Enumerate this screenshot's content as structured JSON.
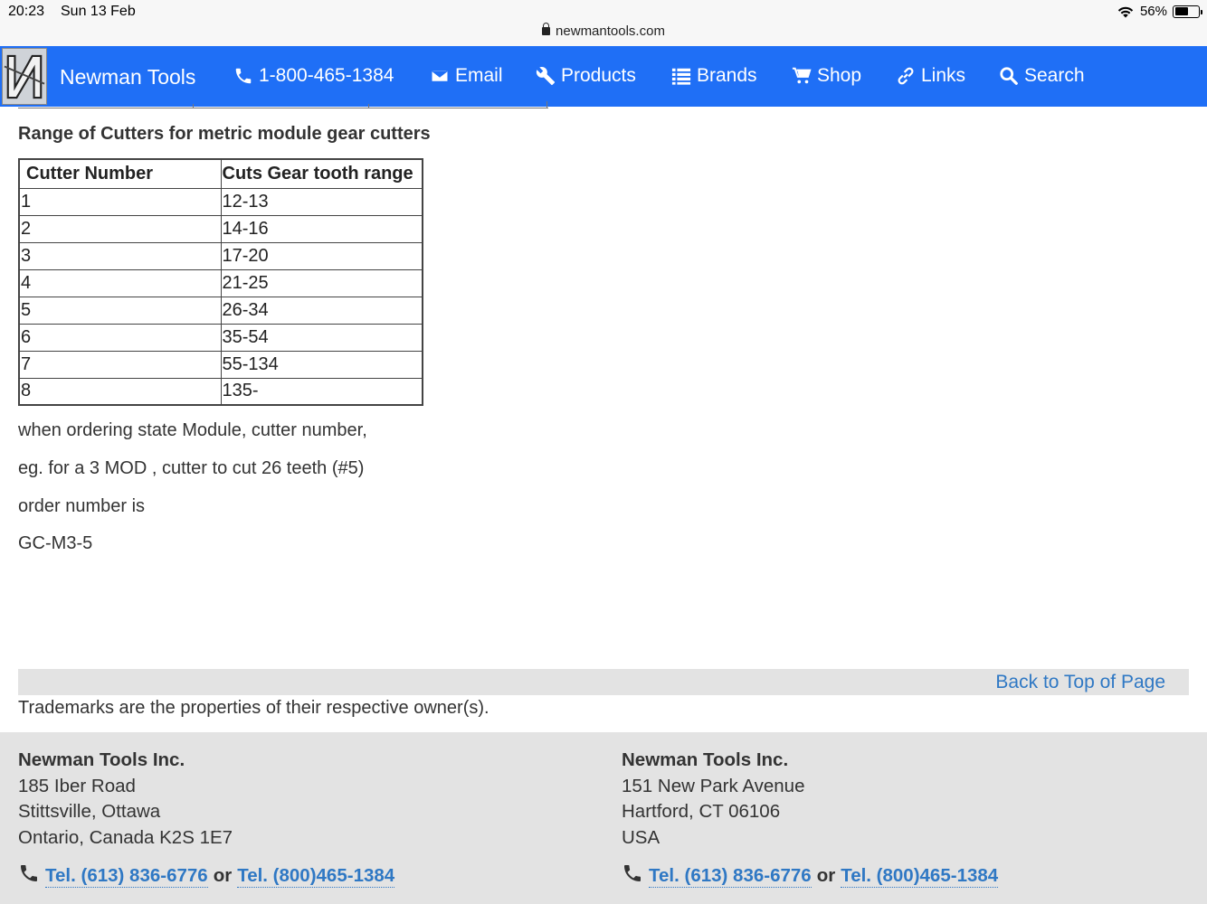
{
  "statusbar": {
    "time": "20:23",
    "date": "Sun 13 Feb",
    "url": "newmantools.com",
    "battery": "56%",
    "battery_level": 0.56
  },
  "nav": {
    "brand": "Newman Tools",
    "phone": "1-800-465-1384",
    "email": "Email",
    "products": "Products",
    "brands": "Brands",
    "shop": "Shop",
    "links": "Links",
    "search": "Search",
    "bg_color": "#1f6ff6"
  },
  "content": {
    "section_title": "Range of Cutters for metric module gear cutters",
    "table": {
      "headers": [
        "Cutter Number",
        "Cuts Gear tooth range"
      ],
      "rows": [
        [
          "1",
          "12-13"
        ],
        [
          "2",
          "14-16"
        ],
        [
          "3",
          "17-20"
        ],
        [
          "4",
          "21-25"
        ],
        [
          "5",
          "26-34"
        ],
        [
          "6",
          "35-54"
        ],
        [
          "7",
          "55-134"
        ],
        [
          "8",
          "135-"
        ]
      ]
    },
    "para1": "when ordering state Module, cutter number,",
    "para2": "eg. for a 3 MOD , cutter to cut 26 teeth (#5)",
    "para3": "order number is",
    "para4": "GC-M3-5",
    "back_to_top": "Back to Top of Page",
    "trademarks": "Trademarks are the properties of their respective owner(s)."
  },
  "footer": {
    "left": {
      "name": "Newman Tools Inc.",
      "line1": "185 Iber Road",
      "line2": "Stittsville, Ottawa",
      "line3": "Ontario, Canada K2S 1E7",
      "tel1": "Tel. (613) 836-6776",
      "or": "or",
      "tel2": "Tel. (800)465-1384"
    },
    "right": {
      "name": "Newman Tools Inc.",
      "line1": "151 New Park Avenue",
      "line2": "Hartford, CT 06106",
      "line3": "USA",
      "tel1": "Tel. (613) 836-6776",
      "or": "or",
      "tel2": "Tel. (800)465-1384"
    }
  }
}
